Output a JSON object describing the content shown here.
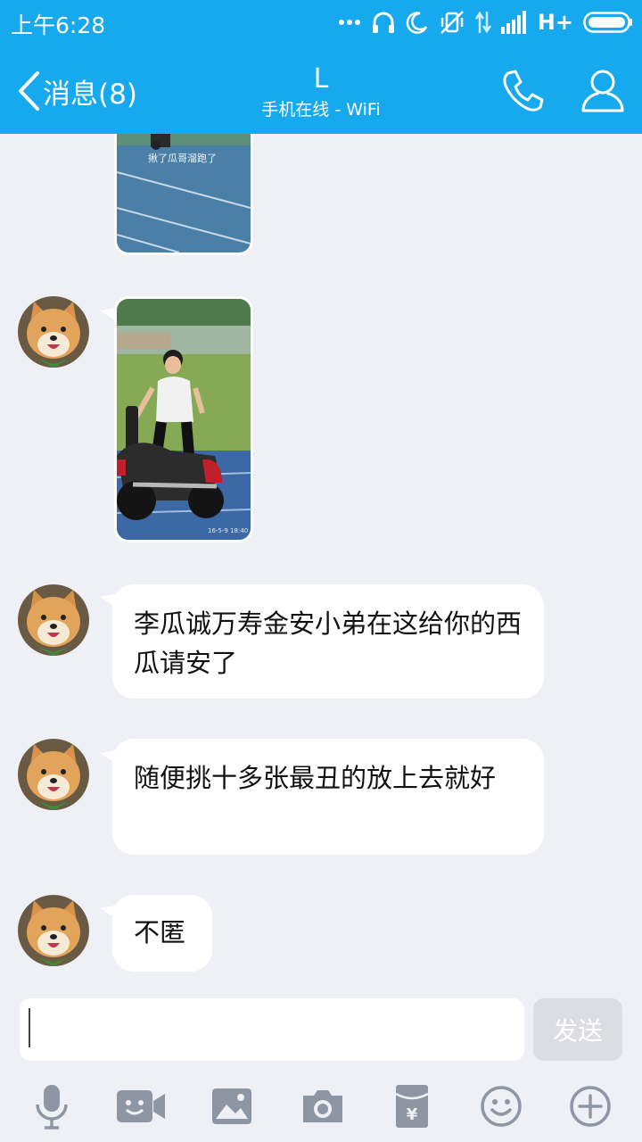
{
  "status_bar": {
    "time": "上午6:28",
    "network": "H+",
    "icons": [
      "more-dots-icon",
      "headset-icon",
      "moon-icon",
      "vibrate-off-icon",
      "data-arrows-icon",
      "signal-icon",
      "battery-icon"
    ]
  },
  "header": {
    "back_label": "消息(8)",
    "title": "L",
    "subtitle": "手机在线 - WiFi",
    "call_icon": "phone-icon",
    "profile_icon": "profile-icon"
  },
  "messages": [
    {
      "type": "image",
      "caption": "揪了瓜哥溜跑了",
      "description": "running track photo"
    },
    {
      "type": "image",
      "timestamp": "16-5-9 18:40",
      "description": "boy riding electric scooter on track"
    },
    {
      "type": "text",
      "text": "李瓜诚万寿金安小弟在这给你的西瓜请安了"
    },
    {
      "type": "text",
      "text": "随便挑十多张最丑的放上去就好"
    },
    {
      "type": "text",
      "text": "不匿"
    }
  ],
  "input": {
    "value": "",
    "send_label": "发送"
  },
  "toolbar": {
    "items": [
      "microphone-icon",
      "video-call-icon",
      "image-icon",
      "camera-icon",
      "red-packet-icon",
      "emoji-icon",
      "plus-icon"
    ]
  },
  "colors": {
    "accent": "#17a9ee",
    "background": "#eef0f5",
    "bubble": "#ffffff",
    "icon_gray": "#8e95a3"
  }
}
